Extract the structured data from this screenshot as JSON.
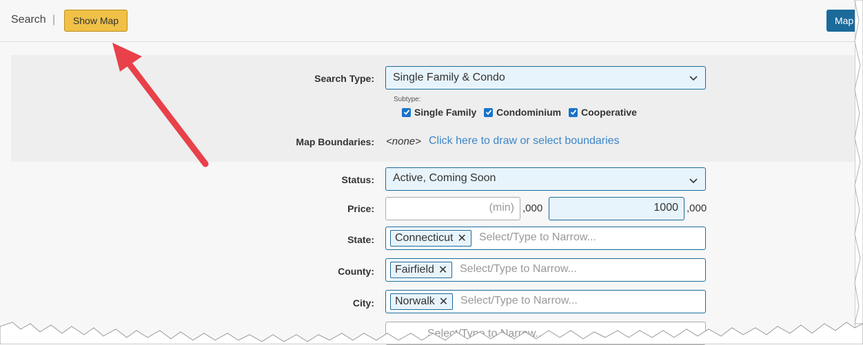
{
  "topbar": {
    "search_label": "Search",
    "separator": "|",
    "show_map_label": "Show Map",
    "map_button_label": "Map"
  },
  "form": {
    "search_type": {
      "label": "Search Type:",
      "value": "Single Family & Condo"
    },
    "subtype": {
      "label": "Subtype:",
      "options": [
        {
          "label": "Single Family",
          "checked": true
        },
        {
          "label": "Condominium",
          "checked": true
        },
        {
          "label": "Cooperative",
          "checked": true
        }
      ]
    },
    "map_boundaries": {
      "label": "Map Boundaries:",
      "value": "<none>",
      "link": "Click here to draw or select boundaries"
    },
    "status": {
      "label": "Status:",
      "value": "Active, Coming Soon"
    },
    "price": {
      "label": "Price:",
      "min_placeholder": "(min)",
      "min_unit": ",000",
      "max_value": "1000",
      "max_unit": ",000"
    },
    "state": {
      "label": "State:",
      "chip": "Connecticut",
      "placeholder": "Select/Type to Narrow..."
    },
    "county": {
      "label": "County:",
      "chip": "Fairfield",
      "placeholder": "Select/Type to Narrow..."
    },
    "city": {
      "label": "City:",
      "chip": "Norwalk",
      "placeholder": "Select/Type to Narrow..."
    },
    "next_field_partial": "Select/Type to Narrow..."
  },
  "colors": {
    "accent_blue": "#1a6a9a",
    "show_map_yellow": "#f0c146",
    "annotation_arrow": "#e8414a",
    "link_blue": "#3a86c8"
  }
}
